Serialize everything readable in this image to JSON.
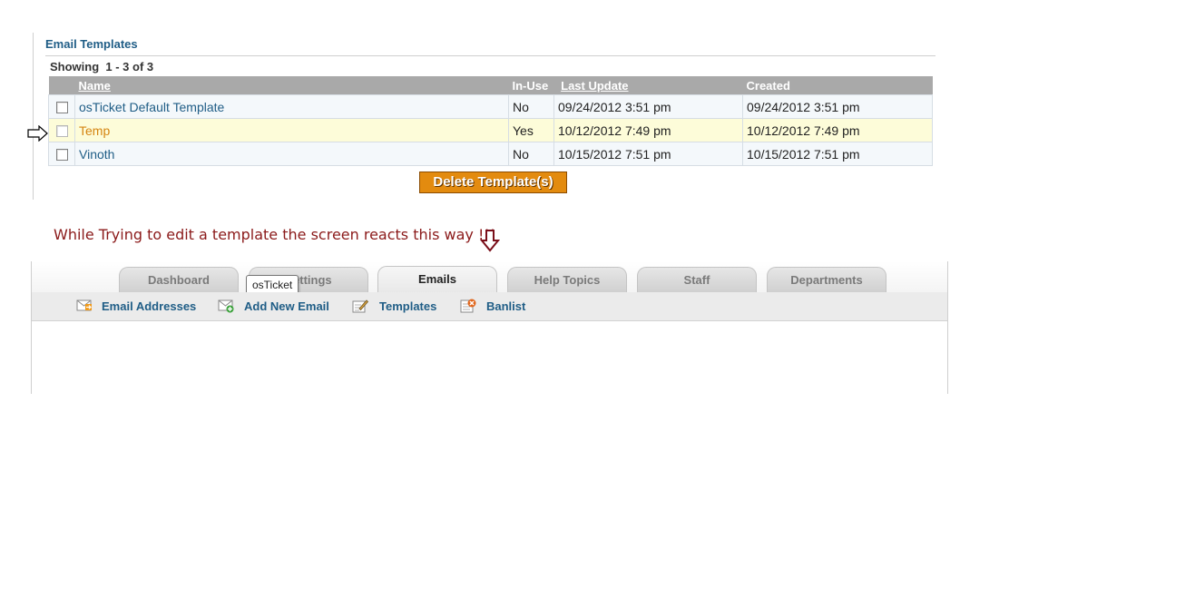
{
  "templates_panel": {
    "title": "Email Templates",
    "showing_text": "Showing  1 - 3 of 3",
    "columns": {
      "name": "Name",
      "in_use": "In-Use",
      "last_update": "Last Update",
      "created": "Created"
    },
    "rows": [
      {
        "name": "osTicket Default Template",
        "in_use": "No",
        "last_update": "09/24/2012 3:51 pm",
        "created": "09/24/2012 3:51 pm",
        "highlighted": false
      },
      {
        "name": "Temp",
        "in_use": "Yes",
        "last_update": "10/12/2012 7:49 pm",
        "created": "10/12/2012 7:49 pm",
        "highlighted": true
      },
      {
        "name": "Vinoth",
        "in_use": "No",
        "last_update": "10/15/2012 7:51 pm",
        "created": "10/15/2012 7:51 pm",
        "highlighted": false
      }
    ],
    "delete_button": "Delete Template(s)"
  },
  "annotation": {
    "text": "While Trying to edit a template the screen reacts this way !!!",
    "color": "#8b1a1a"
  },
  "nav": {
    "tabs": [
      {
        "label": "Dashboard",
        "active": false
      },
      {
        "label": "Settings",
        "active": false
      },
      {
        "label": "Emails",
        "active": true
      },
      {
        "label": "Help Topics",
        "active": false
      },
      {
        "label": "Staff",
        "active": false
      },
      {
        "label": "Departments",
        "active": false
      }
    ],
    "tooltip": "osTicket",
    "subnav": [
      {
        "label": "Email Addresses",
        "icon": "email-addresses-icon"
      },
      {
        "label": "Add New Email",
        "icon": "add-email-icon"
      },
      {
        "label": "Templates",
        "icon": "templates-icon"
      },
      {
        "label": "Banlist",
        "icon": "banlist-icon"
      }
    ]
  },
  "colors": {
    "link": "#1f5d86",
    "highlight_link": "#d58512",
    "header_bg": "#a9a9a9",
    "delete_button": "#e38b0f"
  }
}
